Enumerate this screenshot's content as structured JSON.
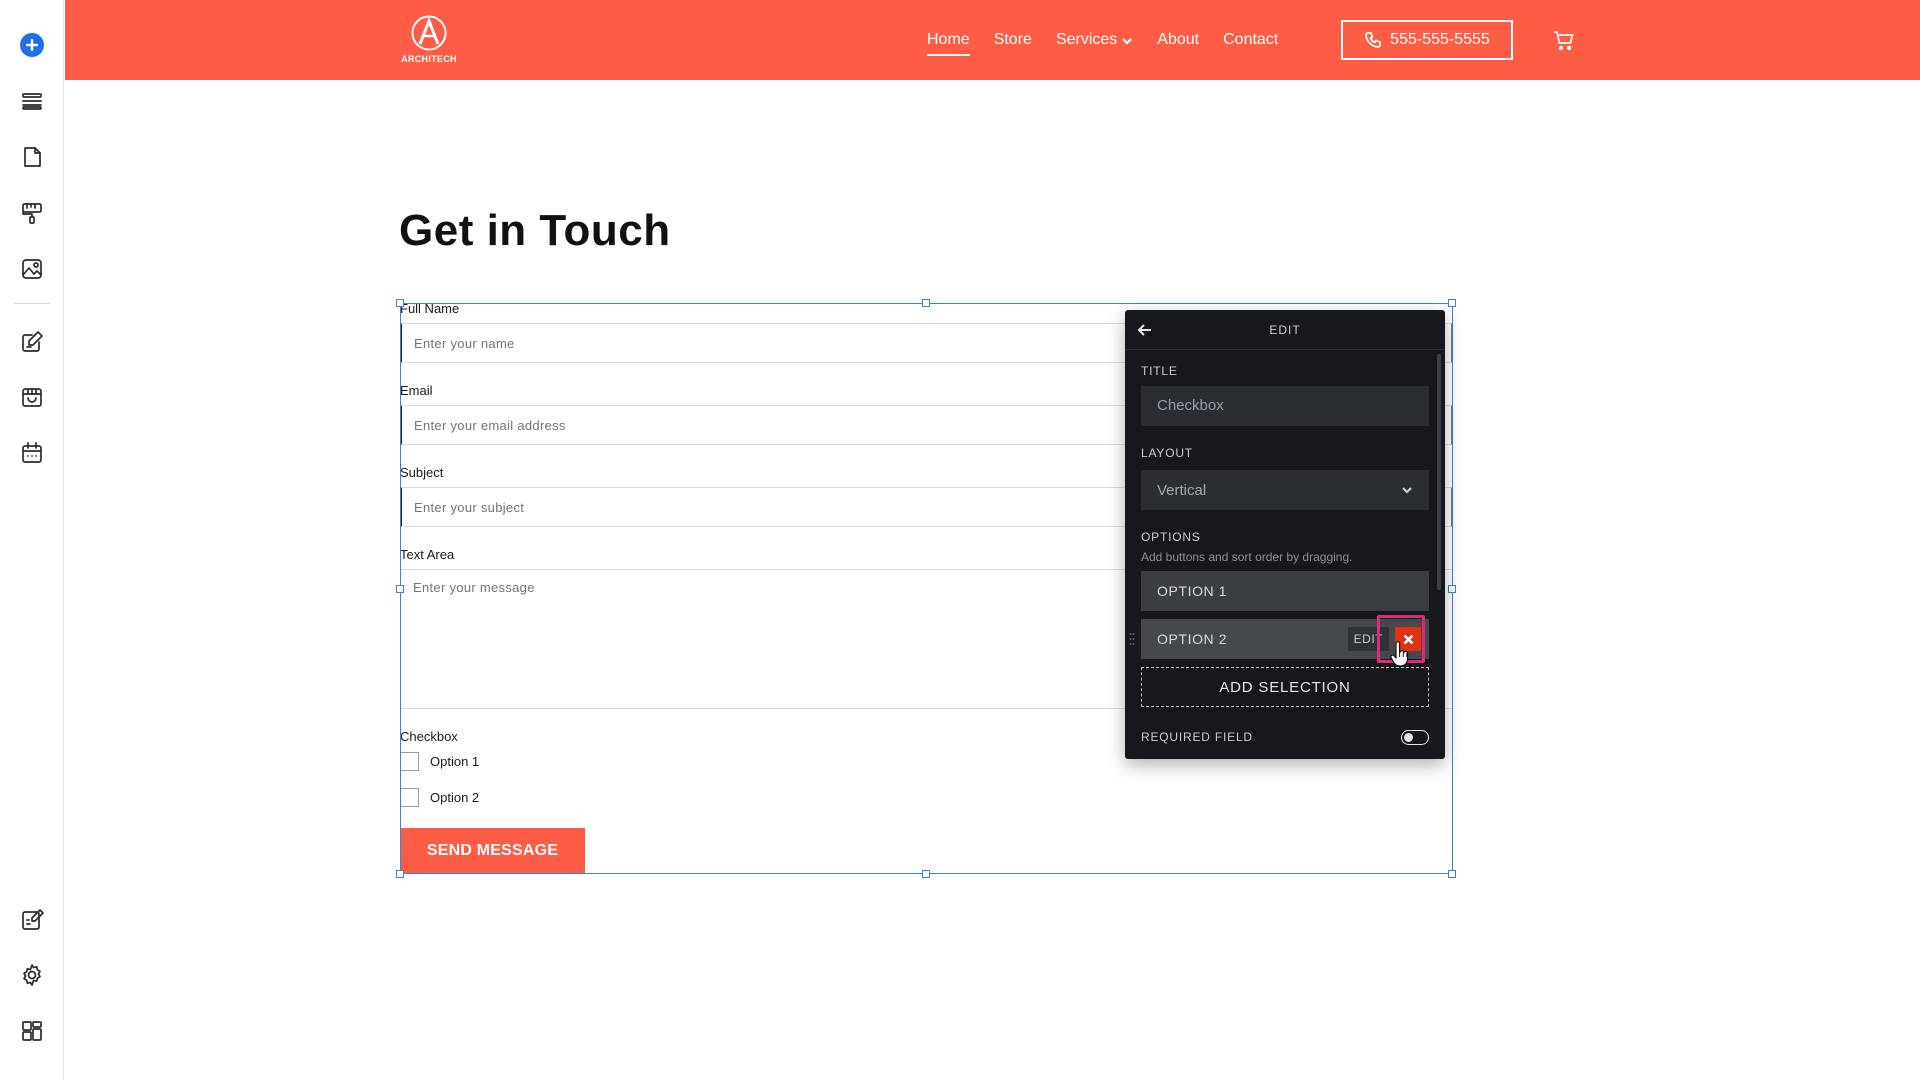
{
  "sidebar": {
    "items": [
      {
        "icon": "add-icon"
      },
      {
        "icon": "layers-icon"
      },
      {
        "icon": "pages-icon"
      },
      {
        "icon": "paint-roller-icon"
      },
      {
        "icon": "image-icon"
      },
      {
        "icon": "edit-content-icon"
      },
      {
        "icon": "store-icon"
      },
      {
        "icon": "calendar-icon"
      },
      {
        "icon": "blog-edit-icon"
      },
      {
        "icon": "gear-icon"
      },
      {
        "icon": "dashboard-icon"
      }
    ],
    "accent_color": "#1e6fe8"
  },
  "header": {
    "brand_color": "#fe5c44",
    "logo_text": "ARCHITECH",
    "nav": [
      {
        "label": "Home",
        "active": true
      },
      {
        "label": "Store",
        "active": false
      },
      {
        "label": "Services",
        "active": false,
        "has_dropdown": true
      },
      {
        "label": "About",
        "active": false
      },
      {
        "label": "Contact",
        "active": false
      }
    ],
    "phone": "555-555-5555"
  },
  "page": {
    "title": "Get in Touch"
  },
  "form": {
    "fields": [
      {
        "label": "Full Name",
        "placeholder": "Enter your name"
      },
      {
        "label": "Email",
        "placeholder": "Enter your email address"
      },
      {
        "label": "Subject",
        "placeholder": "Enter your subject"
      },
      {
        "label": "Text Area",
        "placeholder": "Enter your message"
      }
    ],
    "checkbox": {
      "label": "Checkbox",
      "options": [
        "Option 1",
        "Option 2"
      ]
    },
    "submit_label": "SEND MESSAGE",
    "selection_color": "#3f7fdc"
  },
  "edit_panel": {
    "header": "EDIT",
    "title_label": "TITLE",
    "title_value": "Checkbox",
    "layout_label": "LAYOUT",
    "layout_value": "Vertical",
    "options_label": "OPTIONS",
    "options_help": "Add buttons and sort order by dragging.",
    "options": [
      "OPTION 1",
      "OPTION 2"
    ],
    "option_edit_label": "EDIT",
    "add_selection_label": "ADD SELECTION",
    "required_label": "REQUIRED FIELD",
    "required_on": false,
    "delete_color": "#e53112",
    "highlight_color": "#e02a79"
  }
}
